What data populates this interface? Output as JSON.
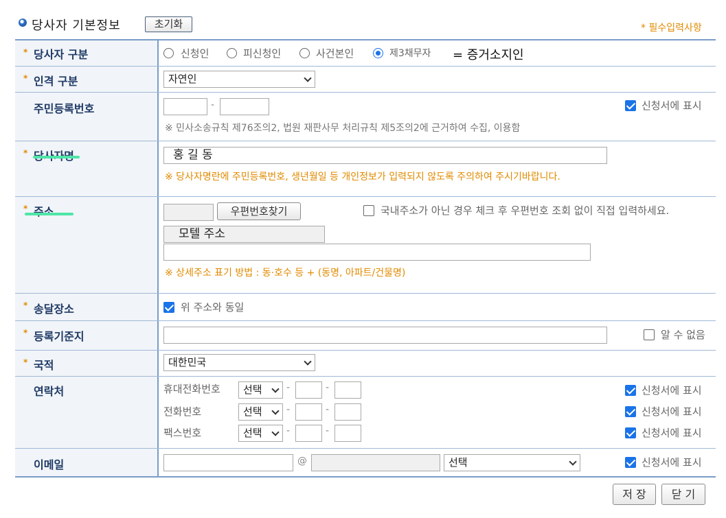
{
  "header": {
    "title": "당사자 기본정보",
    "reset_label": "초기화",
    "required_note": "* 필수입력사항"
  },
  "rows": {
    "party_type": {
      "label": "당사자 구분",
      "options": [
        "신청인",
        "피신청인",
        "사건본인",
        "제3채무자"
      ],
      "selected": "제3채무자",
      "annotation": "= 증거소지인"
    },
    "person_type": {
      "label": "인격 구분",
      "value": "자연인"
    },
    "rrn": {
      "label": "주민등록번호",
      "dash": "-",
      "show_label": "신청서에 표시",
      "note": "※ 민사소송규칙 제76조의2, 법원 재판사무 처리규칙 제5조의2에 근거하여 수집, 이용함"
    },
    "name": {
      "label": "당사자명",
      "value": "홍 길 동",
      "warning": "※ 당사자명란에 주민등록번호, 생년월일 등 개인정보가 입력되지 않도록 주의하여 주시기바랍니다."
    },
    "address": {
      "label": "주소",
      "zip_button": "우편번호찾기",
      "foreign_label": "국내주소가 아닌 경우 체크 후 우편번호 조회 없이 직접 입력하세요.",
      "addr1": "모텔 주소",
      "hint": "※ 상세주소 표기 방법 : 동·호수 등 + (동명, 아파트/건물명)"
    },
    "delivery": {
      "label": "송달장소",
      "same_label": "위 주소와 동일"
    },
    "registry": {
      "label": "등록기준지",
      "unknown_label": "알 수 없음"
    },
    "nationality": {
      "label": "국적",
      "value": "대한민국"
    },
    "contact": {
      "label": "연락처",
      "lines": [
        {
          "name": "휴대전화번호",
          "select": "선택",
          "show_label": "신청서에 표시"
        },
        {
          "name": "전화번호",
          "select": "선택",
          "show_label": "신청서에 표시"
        },
        {
          "name": "팩스번호",
          "select": "선택",
          "show_label": "신청서에 표시"
        }
      ]
    },
    "email": {
      "label": "이메일",
      "at": "@",
      "domain_select": "선택",
      "show_label": "신청서에 표시"
    }
  },
  "footer": {
    "save_label": "저 장",
    "close_label": "닫 기"
  },
  "colors": {
    "required": "#e08a00",
    "label_text": "#1f3a66",
    "label_bg": "#f1f4f8",
    "accent": "#1a73e8",
    "highlight": "#4ee6a8"
  }
}
